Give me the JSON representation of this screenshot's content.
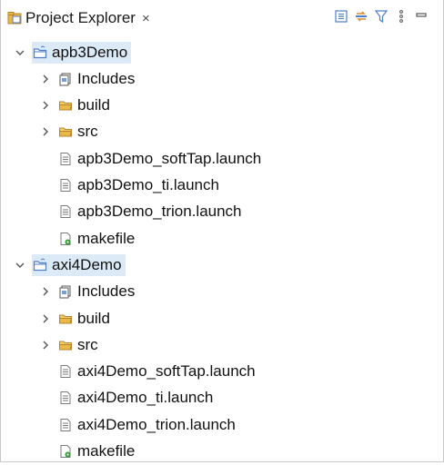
{
  "panel": {
    "title": "Project Explorer",
    "close_glyph": "×",
    "toolbar": [
      {
        "name": "collapse-all-icon"
      },
      {
        "name": "link-with-editor-icon"
      },
      {
        "name": "filter-icon"
      },
      {
        "name": "view-menu-icon"
      },
      {
        "name": "minimize-icon"
      }
    ]
  },
  "tree": [
    {
      "label": "apb3Demo",
      "type": "project",
      "expanded": true,
      "selected": true
    },
    {
      "label": "Includes",
      "type": "includes"
    },
    {
      "label": "build",
      "type": "folder"
    },
    {
      "label": "src",
      "type": "folder"
    },
    {
      "label": "apb3Demo_softTap.launch",
      "type": "file"
    },
    {
      "label": "apb3Demo_ti.launch",
      "type": "file"
    },
    {
      "label": "apb3Demo_trion.launch",
      "type": "file"
    },
    {
      "label": "makefile",
      "type": "makefile"
    },
    {
      "label": "axi4Demo",
      "type": "project",
      "expanded": true,
      "selected": true
    },
    {
      "label": "Includes",
      "type": "includes"
    },
    {
      "label": "build",
      "type": "folder"
    },
    {
      "label": "src",
      "type": "folder"
    },
    {
      "label": "axi4Demo_softTap.launch",
      "type": "file"
    },
    {
      "label": "axi4Demo_ti.launch",
      "type": "file"
    },
    {
      "label": "axi4Demo_trion.launch",
      "type": "file"
    },
    {
      "label": "makefile",
      "type": "makefile"
    }
  ],
  "colors": {
    "selection": "#dceaf8",
    "folder": "#e8b84a",
    "project_folder": "#4f7fc6"
  }
}
